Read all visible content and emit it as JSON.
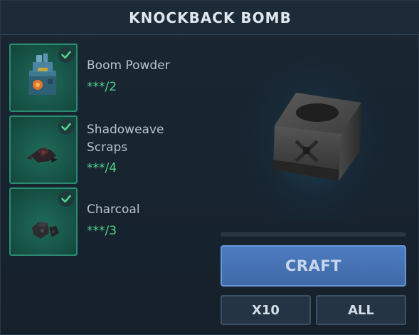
{
  "header": {
    "title": "KNOCKBACK BOMB"
  },
  "ingredients": [
    {
      "name": "Boom Powder",
      "count": "***/2",
      "icon": "boom-powder-icon",
      "complete": true
    },
    {
      "name": "Shadoweave Scraps",
      "count": "***/4",
      "icon": "shadoweave-scraps-icon",
      "complete": true
    },
    {
      "name": "Charcoal",
      "count": "***/3",
      "icon": "charcoal-icon",
      "complete": true
    }
  ],
  "actions": {
    "craft_label": "CRAFT",
    "x10_label": "X10",
    "all_label": "ALL"
  },
  "craft_progress": 0,
  "colors": {
    "accent_green": "#4fd689",
    "slot_border": "#2b8a70",
    "craft_button": "#4675b5",
    "background": "#16212c"
  }
}
